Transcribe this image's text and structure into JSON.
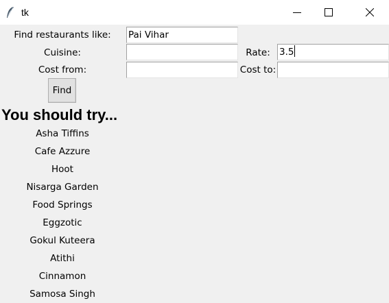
{
  "window": {
    "title": "tk"
  },
  "form": {
    "find_label": "Find restaurants like:",
    "find_value": "Pai Vihar",
    "cuisine_label": "Cuisine:",
    "cuisine_value": "",
    "rate_label": "Rate:",
    "rate_value": "3.5",
    "cost_from_label": "Cost from:",
    "cost_from_value": "",
    "cost_to_label": "Cost to:",
    "cost_to_value": "",
    "find_button": "Find"
  },
  "results": {
    "heading": "You should try...",
    "items": [
      "Asha Tiffins",
      "Cafe Azzure",
      "Hoot",
      "Nisarga Garden",
      "Food Springs",
      "Eggzotic",
      "Gokul Kuteera",
      "Atithi",
      "Cinnamon",
      "Samosa Singh"
    ]
  }
}
